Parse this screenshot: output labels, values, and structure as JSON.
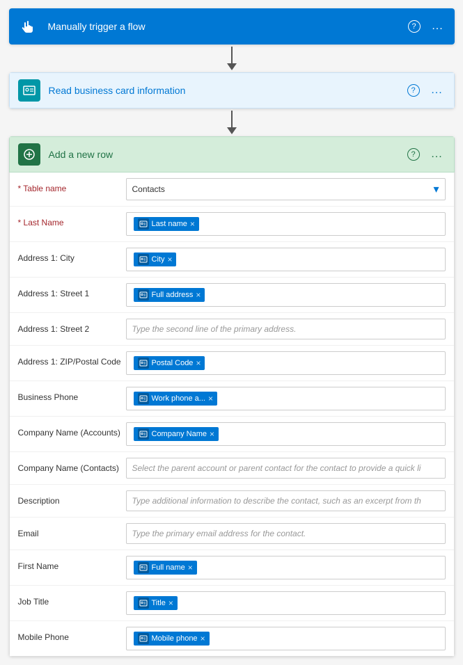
{
  "steps": [
    {
      "id": "trigger",
      "title": "Manually trigger a flow",
      "headerClass": "blue-bg",
      "iconType": "hand",
      "iconBg": "blue",
      "hasHelp": true,
      "hasMore": true
    },
    {
      "id": "business-card",
      "title": "Read business card information",
      "headerClass": "light-blue-bg",
      "iconType": "scan",
      "iconBg": "teal",
      "hasHelp": true,
      "hasMore": true
    },
    {
      "id": "add-row",
      "title": "Add a new row",
      "headerClass": "green-bg",
      "iconType": "dynamics",
      "iconBg": "dark-green",
      "hasHelp": true,
      "hasMore": true,
      "expanded": true
    }
  ],
  "fields": [
    {
      "label": "Table name",
      "required": true,
      "type": "dropdown",
      "value": "Contacts"
    },
    {
      "label": "Last Name",
      "required": true,
      "type": "token",
      "token": {
        "icon": "scan",
        "text": "Last name"
      }
    },
    {
      "label": "Address 1: City",
      "required": false,
      "type": "token",
      "token": {
        "icon": "scan",
        "text": "City"
      }
    },
    {
      "label": "Address 1: Street 1",
      "required": false,
      "type": "token",
      "token": {
        "icon": "scan",
        "text": "Full address"
      }
    },
    {
      "label": "Address 1: Street 2",
      "required": false,
      "type": "placeholder",
      "placeholder": "Type the second line of the primary address."
    },
    {
      "label": "Address 1: ZIP/Postal Code",
      "required": false,
      "type": "token",
      "token": {
        "icon": "scan",
        "text": "Postal Code"
      }
    },
    {
      "label": "Business Phone",
      "required": false,
      "type": "token",
      "token": {
        "icon": "scan",
        "text": "Work phone a..."
      }
    },
    {
      "label": "Company Name (Accounts)",
      "required": false,
      "type": "token",
      "token": {
        "icon": "scan",
        "text": "Company Name"
      }
    },
    {
      "label": "Company Name (Contacts)",
      "required": false,
      "type": "placeholder",
      "placeholder": "Select the parent account or parent contact for the contact to provide a quick li"
    },
    {
      "label": "Description",
      "required": false,
      "type": "placeholder",
      "placeholder": "Type additional information to describe the contact, such as an excerpt from th"
    },
    {
      "label": "Email",
      "required": false,
      "type": "placeholder",
      "placeholder": "Type the primary email address for the contact."
    },
    {
      "label": "First Name",
      "required": false,
      "type": "token",
      "token": {
        "icon": "scan",
        "text": "Full name"
      }
    },
    {
      "label": "Job Title",
      "required": false,
      "type": "token",
      "token": {
        "icon": "scan",
        "text": "Title"
      }
    },
    {
      "label": "Mobile Phone",
      "required": false,
      "type": "token",
      "token": {
        "icon": "scan",
        "text": "Mobile phone"
      }
    }
  ],
  "labels": {
    "help": "?",
    "more": "...",
    "chevron_down": "▾",
    "close": "×"
  }
}
